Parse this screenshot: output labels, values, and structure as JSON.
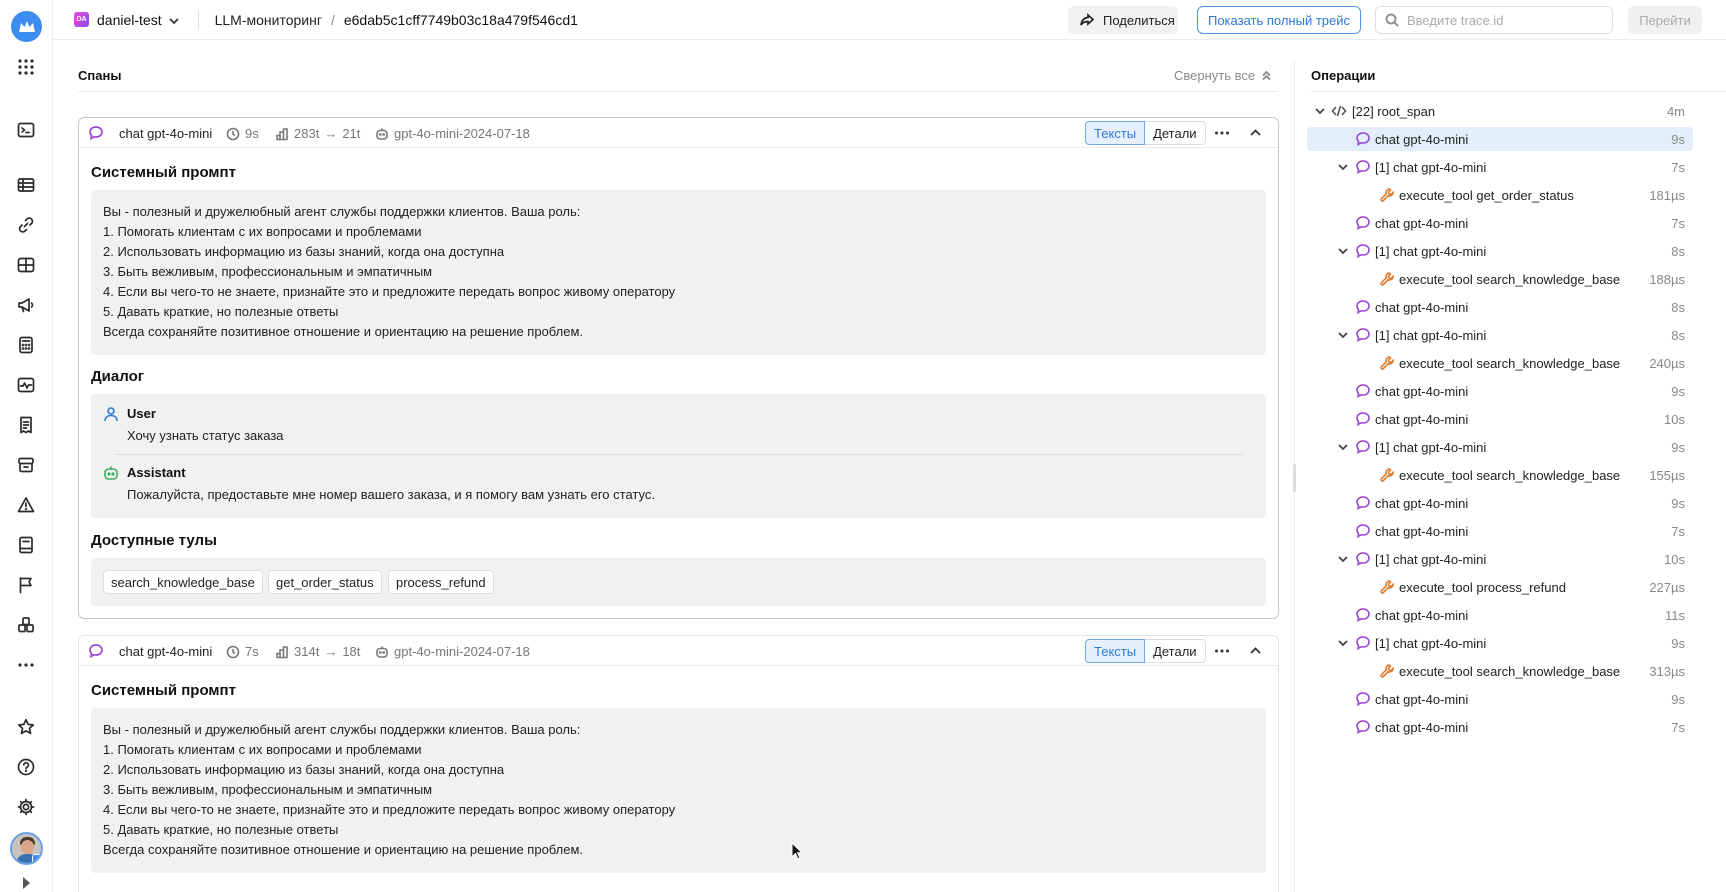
{
  "topbar": {
    "project_badge": "DA",
    "project_name": "daniel-test",
    "breadcrumb_section": "LLM-мониторинг",
    "breadcrumb_sep": "/",
    "trace_id": "e6dab5c1cff7749b03c18a479f546cd1",
    "share_label": "Поделиться",
    "full_trace_label": "Показать полный трейс",
    "search_placeholder": "Введите trace.id",
    "go_label": "Перейти"
  },
  "spans": {
    "title": "Спаны",
    "collapse_all_label": "Свернуть все",
    "cards": [
      {
        "name": "chat gpt-4o-mini",
        "duration": "9s",
        "tokens_in": "283t",
        "arrow": "→",
        "tokens_out": "21t",
        "model": "gpt-4o-mini-2024-07-18",
        "tab_texts": "Тексты",
        "tab_details": "Детали",
        "system_prompt_title": "Системный промпт",
        "system_prompt_lines": [
          "Вы - полезный и дружелюбный агент службы поддержки клиентов. Ваша роль:",
          "1. Помогать клиентам с их вопросами и проблемами",
          "2. Использовать информацию из базы знаний, когда она доступна",
          "3. Быть вежливым, профессиональным и эмпатичным",
          "4. Если вы чего-то не знаете, признайте это и предложите передать вопрос живому оператору",
          "5. Давать краткие, но полезные ответы",
          "Всегда сохраняйте позитивное отношение и ориентацию на решение проблем."
        ],
        "dialog_title": "Диалог",
        "dialog": [
          {
            "role": "User",
            "text": "Хочу узнать статус заказа"
          },
          {
            "role": "Assistant",
            "text": "Пожалуйста, предоставьте мне номер вашего заказа, и я помогу вам узнать его статус."
          }
        ],
        "tools_title": "Доступные тулы",
        "tools": [
          "search_knowledge_base",
          "get_order_status",
          "process_refund"
        ]
      },
      {
        "name": "chat gpt-4o-mini",
        "duration": "7s",
        "tokens_in": "314t",
        "arrow": "→",
        "tokens_out": "18t",
        "model": "gpt-4o-mini-2024-07-18",
        "tab_texts": "Тексты",
        "tab_details": "Детали",
        "system_prompt_title": "Системный промпт",
        "system_prompt_lines": [
          "Вы - полезный и дружелюбный агент службы поддержки клиентов. Ваша роль:",
          "1. Помогать клиентам с их вопросами и проблемами",
          "2. Использовать информацию из базы знаний, когда она доступна",
          "3. Быть вежливым, профессиональным и эмпатичным",
          "4. Если вы чего-то не знаете, признайте это и предложите передать вопрос живому оператору",
          "5. Давать краткие, но полезные ответы",
          "Всегда сохраняйте позитивное отношение и ориентацию на решение проблем."
        ]
      }
    ]
  },
  "operations": {
    "title": "Операции",
    "rows": [
      {
        "label": "[22] root_span",
        "duration": "4m",
        "level": 0,
        "kind": "root",
        "toggle": true,
        "selected": false
      },
      {
        "label": "chat gpt-4o-mini",
        "duration": "9s",
        "level": 1,
        "kind": "chat",
        "toggle": false,
        "selected": true
      },
      {
        "label": "[1] chat gpt-4o-mini",
        "duration": "7s",
        "level": 1,
        "kind": "chat",
        "toggle": true,
        "selected": false
      },
      {
        "label": "execute_tool get_order_status",
        "duration": "181µs",
        "level": 2,
        "kind": "tool",
        "toggle": false,
        "selected": false
      },
      {
        "label": "chat gpt-4o-mini",
        "duration": "7s",
        "level": 1,
        "kind": "chat",
        "toggle": false,
        "selected": false
      },
      {
        "label": "[1] chat gpt-4o-mini",
        "duration": "8s",
        "level": 1,
        "kind": "chat",
        "toggle": true,
        "selected": false
      },
      {
        "label": "execute_tool search_knowledge_base",
        "duration": "188µs",
        "level": 2,
        "kind": "tool",
        "toggle": false,
        "selected": false
      },
      {
        "label": "chat gpt-4o-mini",
        "duration": "8s",
        "level": 1,
        "kind": "chat",
        "toggle": false,
        "selected": false
      },
      {
        "label": "[1] chat gpt-4o-mini",
        "duration": "8s",
        "level": 1,
        "kind": "chat",
        "toggle": true,
        "selected": false
      },
      {
        "label": "execute_tool search_knowledge_base",
        "duration": "240µs",
        "level": 2,
        "kind": "tool",
        "toggle": false,
        "selected": false
      },
      {
        "label": "chat gpt-4o-mini",
        "duration": "9s",
        "level": 1,
        "kind": "chat",
        "toggle": false,
        "selected": false
      },
      {
        "label": "chat gpt-4o-mini",
        "duration": "10s",
        "level": 1,
        "kind": "chat",
        "toggle": false,
        "selected": false
      },
      {
        "label": "[1] chat gpt-4o-mini",
        "duration": "9s",
        "level": 1,
        "kind": "chat",
        "toggle": true,
        "selected": false
      },
      {
        "label": "execute_tool search_knowledge_base",
        "duration": "155µs",
        "level": 2,
        "kind": "tool",
        "toggle": false,
        "selected": false
      },
      {
        "label": "chat gpt-4o-mini",
        "duration": "9s",
        "level": 1,
        "kind": "chat",
        "toggle": false,
        "selected": false
      },
      {
        "label": "chat gpt-4o-mini",
        "duration": "7s",
        "level": 1,
        "kind": "chat",
        "toggle": false,
        "selected": false
      },
      {
        "label": "[1] chat gpt-4o-mini",
        "duration": "10s",
        "level": 1,
        "kind": "chat",
        "toggle": true,
        "selected": false
      },
      {
        "label": "execute_tool process_refund",
        "duration": "227µs",
        "level": 2,
        "kind": "tool",
        "toggle": false,
        "selected": false
      },
      {
        "label": "chat gpt-4o-mini",
        "duration": "11s",
        "level": 1,
        "kind": "chat",
        "toggle": false,
        "selected": false
      },
      {
        "label": "[1] chat gpt-4o-mini",
        "duration": "9s",
        "level": 1,
        "kind": "chat",
        "toggle": true,
        "selected": false
      },
      {
        "label": "execute_tool search_knowledge_base",
        "duration": "313µs",
        "level": 2,
        "kind": "tool",
        "toggle": false,
        "selected": false
      },
      {
        "label": "chat gpt-4o-mini",
        "duration": "9s",
        "level": 1,
        "kind": "chat",
        "toggle": false,
        "selected": false
      },
      {
        "label": "chat gpt-4o-mini",
        "duration": "7s",
        "level": 1,
        "kind": "chat",
        "toggle": false,
        "selected": false
      }
    ]
  },
  "colors": {
    "accent": "#2c7ad8",
    "chat_icon": "#9b49d6",
    "tool_icon": "#e07a2e",
    "selected_row": "#e3eefb"
  },
  "rail": {
    "icons": [
      "logo-icon",
      "apps-grid-icon",
      "terminal-icon",
      "table-icon",
      "link-icon",
      "dashboard-icon",
      "megaphone-icon",
      "calculator-icon",
      "monitoring-icon",
      "checklist-icon",
      "storage-icon",
      "alert-icon",
      "book-icon",
      "flag-icon",
      "stack-icon",
      "more-icon",
      "star-icon",
      "help-icon",
      "settings-icon",
      "avatar"
    ]
  }
}
